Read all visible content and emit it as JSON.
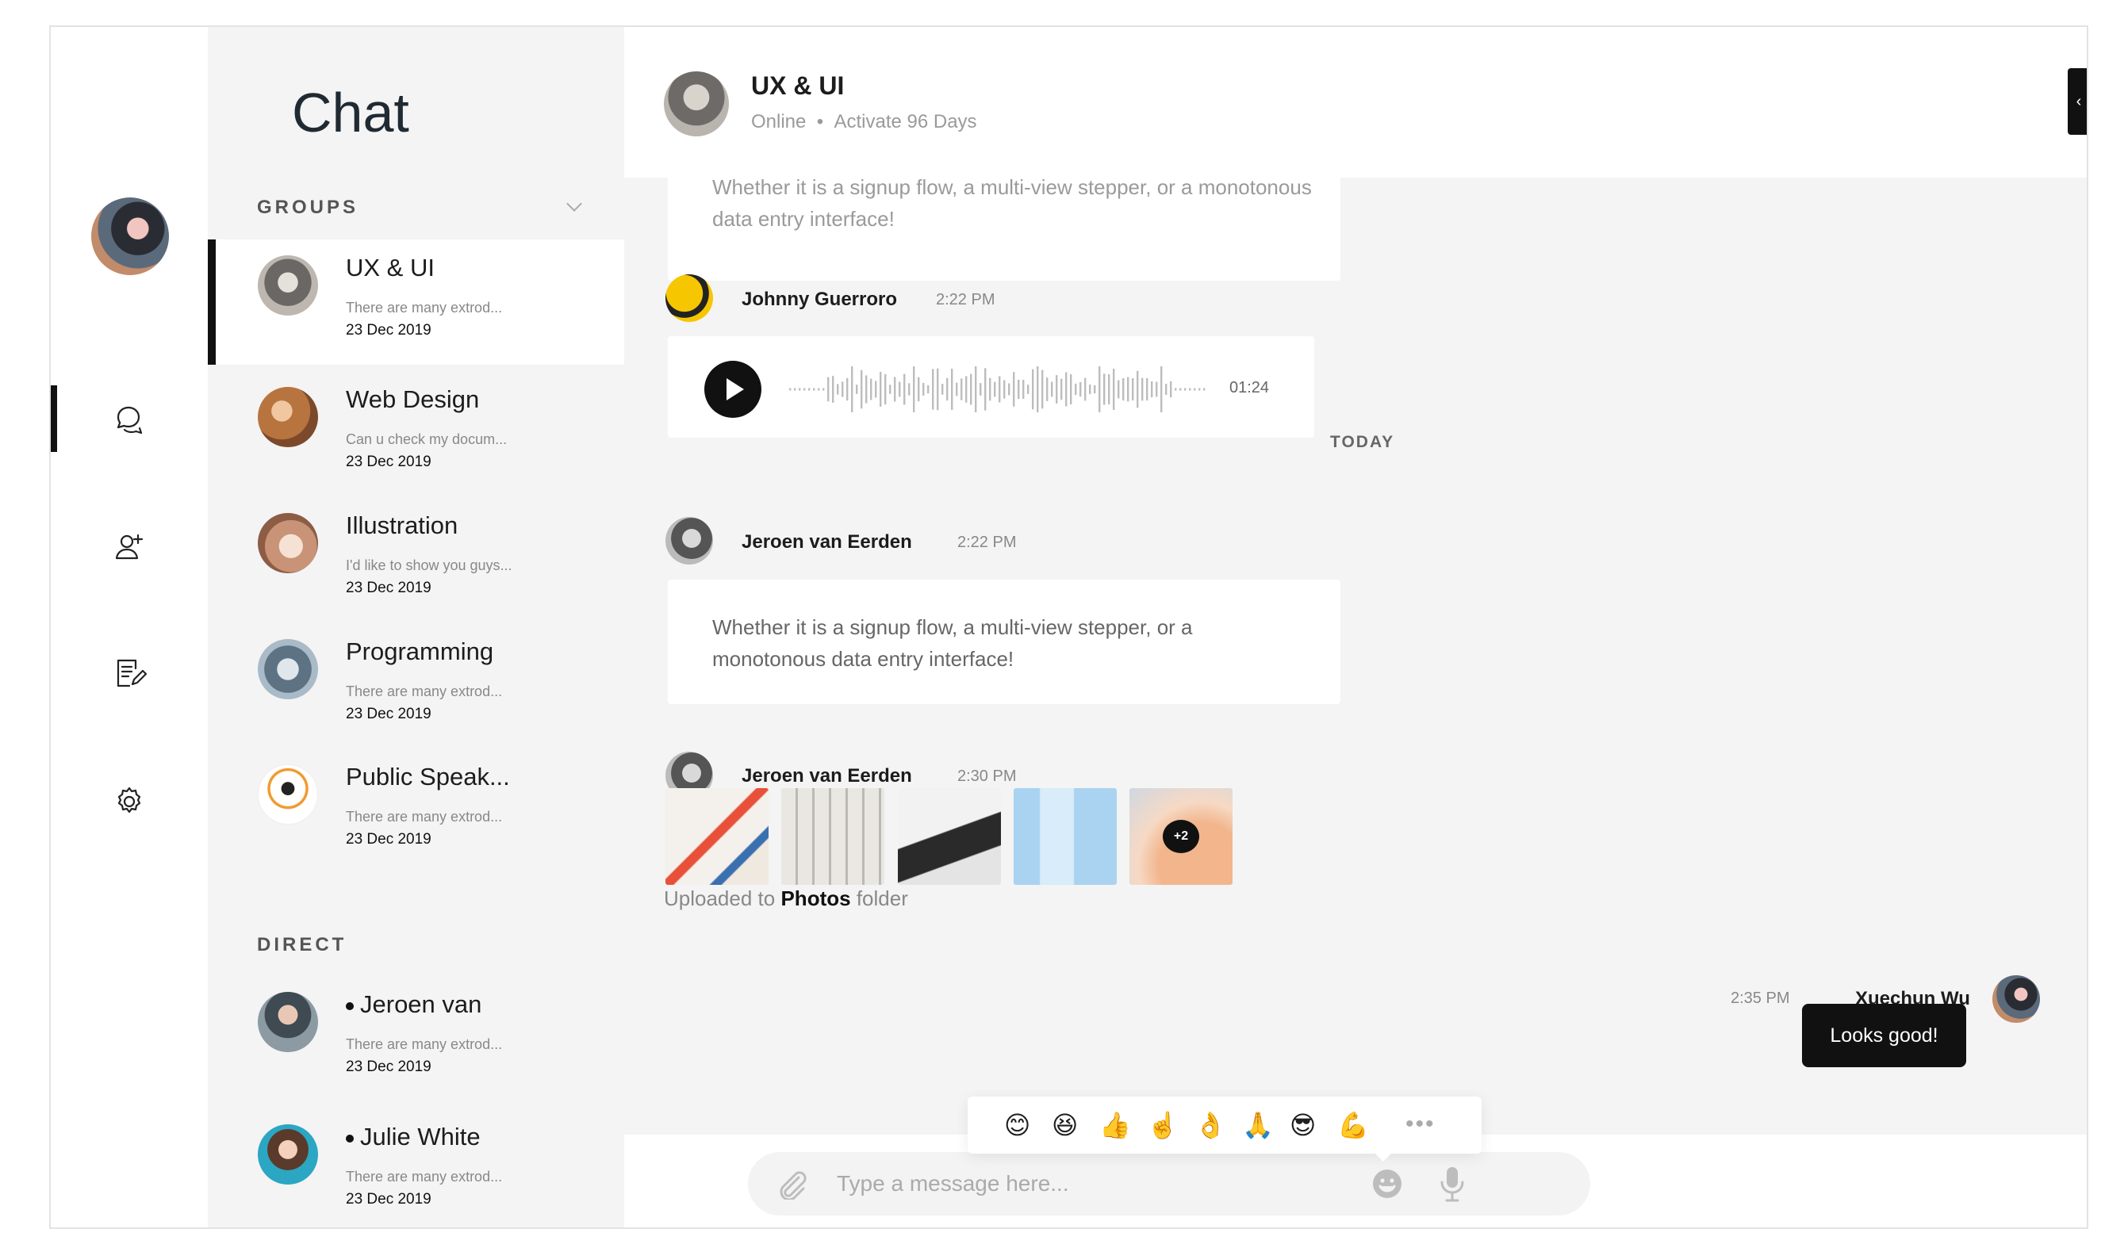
{
  "sidebar": {
    "title": "Chat",
    "groups_label": "GROUPS",
    "direct_label": "DIRECT",
    "groups": [
      {
        "name": "UX & UI",
        "preview": "There are many extrod...",
        "date": "23 Dec 2019"
      },
      {
        "name": "Web Design",
        "preview": "Can u check my docum...",
        "date": "23 Dec 2019"
      },
      {
        "name": "Illustration",
        "preview": "I'd like to show you guys...",
        "date": "23 Dec 2019"
      },
      {
        "name": "Programming",
        "preview": "There are many extrod...",
        "date": "23 Dec 2019"
      },
      {
        "name": "Public Speak...",
        "preview": "There are many extrod...",
        "date": "23 Dec 2019"
      }
    ],
    "direct": [
      {
        "name": "Jeroen van",
        "preview": "There are many extrod...",
        "date": "23 Dec 2019"
      },
      {
        "name": "Julie White",
        "preview": "There are many extrod...",
        "date": "23 Dec 2019"
      }
    ]
  },
  "header": {
    "title": "UX & UI",
    "status": "Online",
    "separator": "•",
    "activity": "Activate 96 Days"
  },
  "messages": {
    "cut_text": "Whether it is a signup flow, a multi-view stepper, or a monotonous data entry interface!",
    "voice": {
      "sender": "Johnny Guerroro",
      "time": "2:22 PM",
      "duration": "01:24"
    },
    "day_divider": "TODAY",
    "text_msg": {
      "sender": "Jeroen van Eerden",
      "time": "2:22 PM",
      "line1": "Whether it is a signup flow, a multi-view stepper, or a",
      "line2": "monotonous data entry interface!"
    },
    "photo_msg": {
      "sender": "Jeroen van Eerden",
      "time": "2:30 PM",
      "more": "+2",
      "uploaded_prefix": "Uploaded to",
      "uploaded_folder": "Photos",
      "uploaded_suffix": "folder"
    },
    "mine": {
      "sender": "Xuechun Wu",
      "time": "2:35 PM",
      "text": "Looks good!"
    }
  },
  "composer": {
    "placeholder": "Type a message here...",
    "emojis": [
      "😊",
      "😆",
      "👍",
      "☝️",
      "👌",
      "🙏",
      "😎",
      "💪"
    ],
    "more": "•••"
  },
  "icons": {
    "rail": [
      "chat-icon",
      "add-user-icon",
      "edit-document-icon",
      "settings-icon"
    ],
    "composer": [
      "paperclip-icon",
      "emoji-icon",
      "microphone-icon"
    ]
  },
  "colors": {
    "accent": "#111111",
    "panel_bg": "#f4f4f4",
    "muted_text": "#888888"
  }
}
